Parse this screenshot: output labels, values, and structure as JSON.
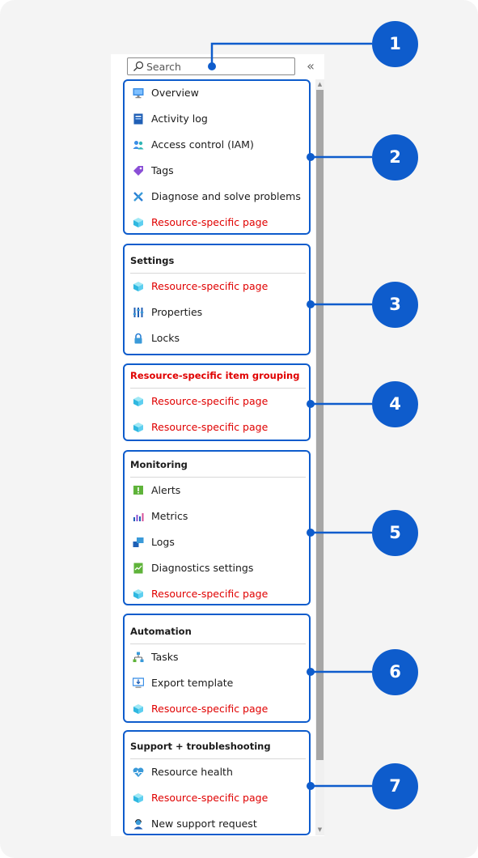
{
  "search": {
    "placeholder": "Search"
  },
  "collapse_glyph": "«",
  "groups": [
    {
      "header": "",
      "items": [
        {
          "label": "Overview",
          "icon": "overview-icon",
          "highlight": false
        },
        {
          "label": "Activity log",
          "icon": "activity-log-icon",
          "highlight": false
        },
        {
          "label": "Access control (IAM)",
          "icon": "access-control-icon",
          "highlight": false
        },
        {
          "label": "Tags",
          "icon": "tag-icon",
          "highlight": false
        },
        {
          "label": "Diagnose and solve problems",
          "icon": "diagnose-icon",
          "highlight": false
        },
        {
          "label": "Resource-specific page",
          "icon": "cube-icon",
          "highlight": true
        }
      ]
    },
    {
      "header": "Settings",
      "items": [
        {
          "label": "Resource-specific page",
          "icon": "cube-icon",
          "highlight": true
        },
        {
          "label": "Properties",
          "icon": "properties-icon",
          "highlight": false
        },
        {
          "label": "Locks",
          "icon": "lock-icon",
          "highlight": false
        }
      ]
    },
    {
      "header": "Resource-specific item grouping",
      "header_highlight": true,
      "items": [
        {
          "label": "Resource-specific page",
          "icon": "cube-icon",
          "highlight": true
        },
        {
          "label": "Resource-specific page",
          "icon": "cube-icon",
          "highlight": true
        }
      ]
    },
    {
      "header": "Monitoring",
      "items": [
        {
          "label": "Alerts",
          "icon": "alert-icon",
          "highlight": false
        },
        {
          "label": "Metrics",
          "icon": "metrics-icon",
          "highlight": false
        },
        {
          "label": "Logs",
          "icon": "logs-icon",
          "highlight": false
        },
        {
          "label": "Diagnostics settings",
          "icon": "diagnostics-icon",
          "highlight": false
        },
        {
          "label": "Resource-specific page",
          "icon": "cube-icon",
          "highlight": true
        }
      ]
    },
    {
      "header": "Automation",
      "items": [
        {
          "label": "Tasks",
          "icon": "tasks-icon",
          "highlight": false
        },
        {
          "label": "Export template",
          "icon": "export-template-icon",
          "highlight": false
        },
        {
          "label": "Resource-specific page",
          "icon": "cube-icon",
          "highlight": true
        }
      ]
    },
    {
      "header": "Support + troubleshooting",
      "items": [
        {
          "label": "Resource health",
          "icon": "heart-icon",
          "highlight": false
        },
        {
          "label": "Resource-specific page",
          "icon": "cube-icon",
          "highlight": true
        },
        {
          "label": "New support request",
          "icon": "support-person-icon",
          "highlight": false
        }
      ]
    }
  ],
  "callouts": [
    "1",
    "2",
    "3",
    "4",
    "5",
    "6",
    "7"
  ],
  "colors": {
    "accent": "#0e5ccc",
    "highlight_text": "#e00000"
  }
}
